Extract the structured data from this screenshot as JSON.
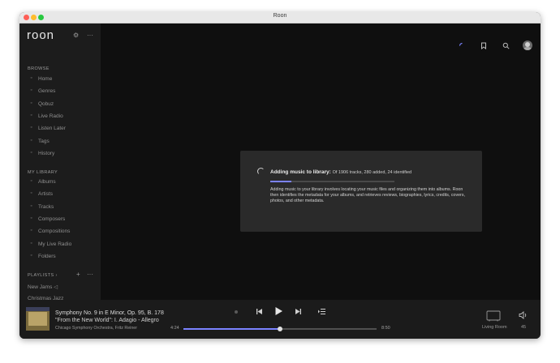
{
  "window": {
    "title": "Roon"
  },
  "sidebar": {
    "logo": "roon",
    "browse_label": "BROWSE",
    "browse_items": [
      {
        "label": "Home",
        "icon": "home-icon"
      },
      {
        "label": "Genres",
        "icon": "genres-icon"
      },
      {
        "label": "Qobuz",
        "icon": "qobuz-icon"
      },
      {
        "label": "Live Radio",
        "icon": "radio-icon"
      },
      {
        "label": "Listen Later",
        "icon": "clock-icon"
      },
      {
        "label": "Tags",
        "icon": "tag-icon"
      },
      {
        "label": "History",
        "icon": "history-icon"
      }
    ],
    "library_label": "MY LIBRARY",
    "library_items": [
      {
        "label": "Albums",
        "icon": "album-icon"
      },
      {
        "label": "Artists",
        "icon": "artist-icon"
      },
      {
        "label": "Tracks",
        "icon": "tracks-icon"
      },
      {
        "label": "Composers",
        "icon": "composer-icon"
      },
      {
        "label": "Compositions",
        "icon": "compositions-icon"
      },
      {
        "label": "My Live Radio",
        "icon": "radio-icon"
      },
      {
        "label": "Folders",
        "icon": "folder-icon"
      }
    ],
    "playlists_label": "PLAYLISTS",
    "playlists": [
      "New Jams",
      "Christmas Jazz"
    ]
  },
  "modal": {
    "title": "Adding music to library:",
    "status": "Of 1906 tracks, 280 added, 24 identified",
    "progress": 0.17,
    "description": "Adding music to your library involves locating your music files and organizing them into albums. Roon then identifies the metadata for your albums, and retrieves reviews, biographies, lyrics, credits, covers, photos, and other metadata."
  },
  "player": {
    "track_title": "Symphony No. 9 in E Minor, Op. 95, B. 178",
    "track_movement": "\"From the New World\": I. Adagio - Allegro",
    "artist": "Chicago Symphony Orchestra, Fritz Reiner",
    "elapsed": "4:24",
    "duration": "8:50",
    "position": 0.5,
    "zone": "Living Room",
    "volume": "45"
  },
  "colors": {
    "accent": "#7b83ff",
    "background": "#0f0f0f",
    "sidebar": "#1c1c1c"
  }
}
